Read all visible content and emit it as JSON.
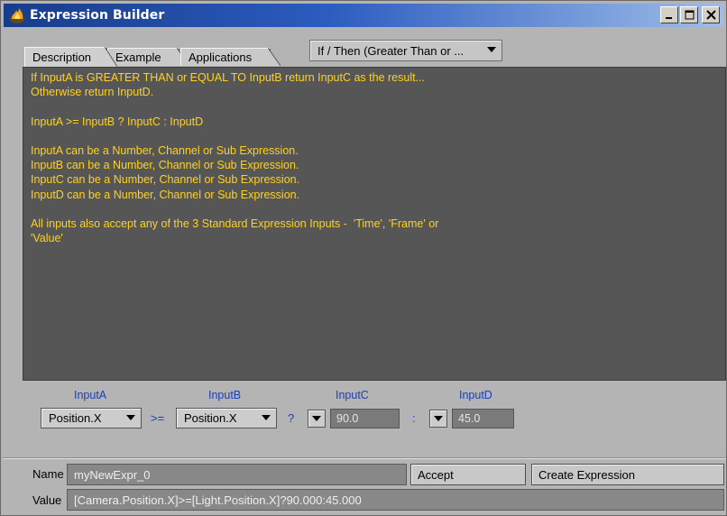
{
  "window": {
    "title": "Expression Builder",
    "icon": "lightwave-flame-icon",
    "controls": [
      "minimize",
      "maximize",
      "close"
    ]
  },
  "tabs": [
    {
      "label": "Description",
      "active": true
    },
    {
      "label": "Example",
      "active": false
    },
    {
      "label": "Applications",
      "active": false
    }
  ],
  "function_select": {
    "value": "If / Then (Greater Than or  ..."
  },
  "description": {
    "text_color": "#ffd21e",
    "lines": [
      "If InputA is GREATER THAN or EQUAL TO InputB return InputC as the result...",
      "Otherwise return InputD.",
      "",
      "InputA >= InputB ? InputC : InputD",
      "",
      "InputA can be a Number, Channel or Sub Expression.",
      "InputB can be a Number, Channel or Sub Expression.",
      "InputC can be a Number, Channel or Sub Expression.",
      "InputD can be a Number, Channel or Sub Expression.",
      "",
      "All inputs also accept any of the 3 Standard Expression Inputs -  'Time', 'Frame' or",
      "'Value'"
    ]
  },
  "inputs": {
    "label_color": "#1a3fb8",
    "a": {
      "label": "InputA",
      "value": "Position.X"
    },
    "op1": ">=",
    "b": {
      "label": "InputB",
      "value": "Position.X"
    },
    "op2": "?",
    "c": {
      "label": "InputC",
      "value": "90.0"
    },
    "op3": ":",
    "d": {
      "label": "InputD",
      "value": "45.0"
    }
  },
  "name_row": {
    "label": "Name",
    "value": "myNewExpr_0"
  },
  "accept_button": "Accept",
  "create_button": "Create Expression",
  "value_row": {
    "label": "Value",
    "value": "[Camera.Position.X]>=[Light.Position.X]?90.000:45.000"
  }
}
